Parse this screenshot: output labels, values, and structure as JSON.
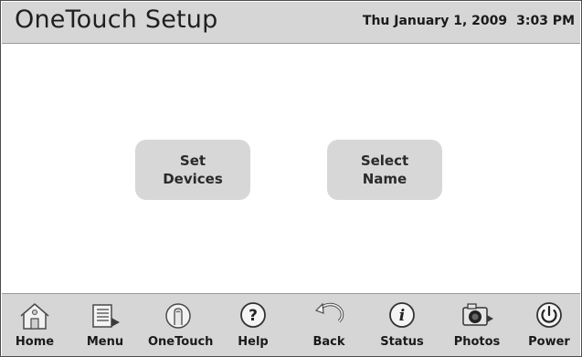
{
  "header": {
    "title": "OneTouch Setup",
    "date": "Thu January 1, 2009",
    "time": "3:03 PM"
  },
  "main": {
    "buttons": [
      {
        "line1": "Set",
        "line2": "Devices"
      },
      {
        "line1": "Select",
        "line2": "Name"
      }
    ]
  },
  "footer": {
    "items": [
      {
        "label": "Home",
        "icon": "home-icon"
      },
      {
        "label": "Menu",
        "icon": "menu-icon"
      },
      {
        "label": "OneTouch",
        "icon": "onetouch-icon"
      },
      {
        "label": "Help",
        "icon": "help-icon"
      },
      {
        "label": "Back",
        "icon": "back-icon"
      },
      {
        "label": "Status",
        "icon": "status-icon"
      },
      {
        "label": "Photos",
        "icon": "camera-icon"
      },
      {
        "label": "Power",
        "icon": "power-icon"
      }
    ]
  },
  "colors": {
    "bar_background": "#d6d6d6",
    "button_background": "#d7d7d7",
    "text": "#1a1a1a"
  }
}
